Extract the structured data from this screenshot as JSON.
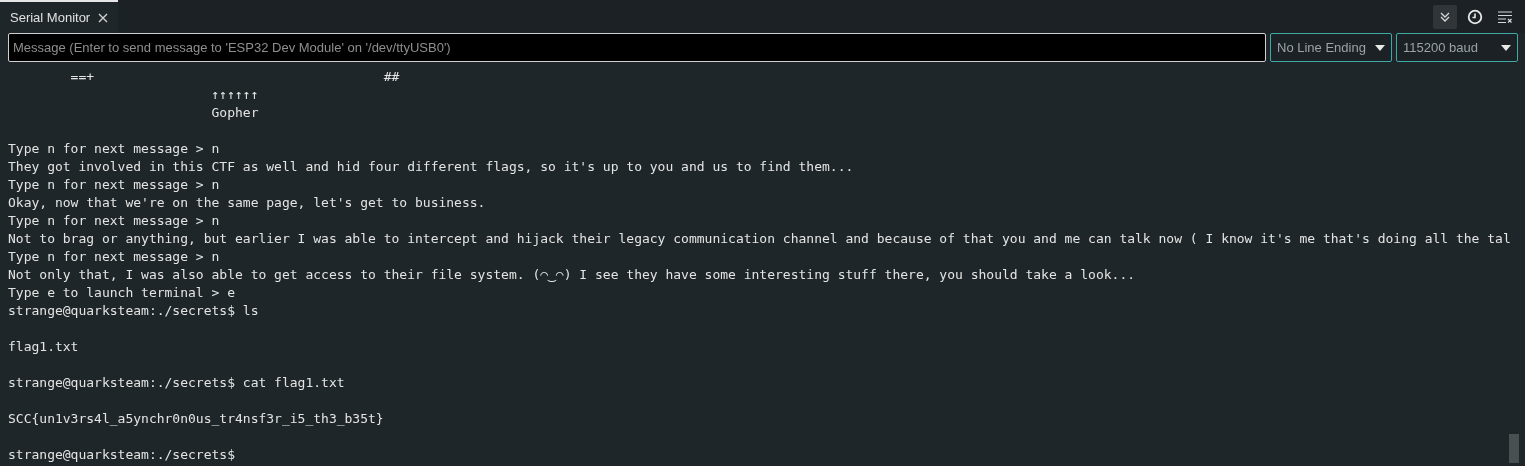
{
  "tabs": [
    {
      "label": "Serial Monitor",
      "selected": true
    }
  ],
  "toolbar": {
    "autoscroll_on": true,
    "timestamp_on": false
  },
  "message_field": {
    "placeholder": "Message (Enter to send message to 'ESP32 Dev Module' on '/dev/ttyUSB0')"
  },
  "line_ending": {
    "value": "No Line Ending"
  },
  "baud_rate": {
    "value": "115200 baud"
  },
  "output": [
    {
      "kind": "text",
      "text": "        ==+                                     ##"
    },
    {
      "kind": "text",
      "text": "                          ↑↑↑↑↑↑"
    },
    {
      "kind": "text",
      "text": "                          Gopher"
    },
    {
      "kind": "blank"
    },
    {
      "kind": "text",
      "text": "Type n for next message > n"
    },
    {
      "kind": "text",
      "text": "They got involved in this CTF as well and hid four different flags, so it's up to you and us to find them..."
    },
    {
      "kind": "text",
      "text": "Type n for next message > n"
    },
    {
      "kind": "text",
      "text": "Okay, now that we're on the same page, let's get to business."
    },
    {
      "kind": "text",
      "text": "Type n for next message > n"
    },
    {
      "kind": "text",
      "text": "Not to brag or anything, but earlier I was able to intercept and hijack their legacy communication channel and because of that you and me can talk now ( I know it's me that's doing all the tal"
    },
    {
      "kind": "text",
      "text": "Type n for next message > n"
    },
    {
      "kind": "text",
      "text": "Not only that, I was also able to get access to their file system. (◠‿◠) I see they have some interesting stuff there, you should take a look..."
    },
    {
      "kind": "text",
      "text": "Type e to launch terminal > e"
    },
    {
      "kind": "text",
      "text": "strange@quarksteam:./secrets$ ls"
    },
    {
      "kind": "blank"
    },
    {
      "kind": "text",
      "text": "flag1.txt"
    },
    {
      "kind": "blank"
    },
    {
      "kind": "text",
      "text": "strange@quarksteam:./secrets$ cat flag1.txt"
    },
    {
      "kind": "blank"
    },
    {
      "kind": "text",
      "text": "SCC{un1v3rs4l_a5ynchr0n0us_tr4nsf3r_i5_th3_b35t}"
    },
    {
      "kind": "blank"
    },
    {
      "kind": "text",
      "text": "strange@quarksteam:./secrets$"
    }
  ]
}
